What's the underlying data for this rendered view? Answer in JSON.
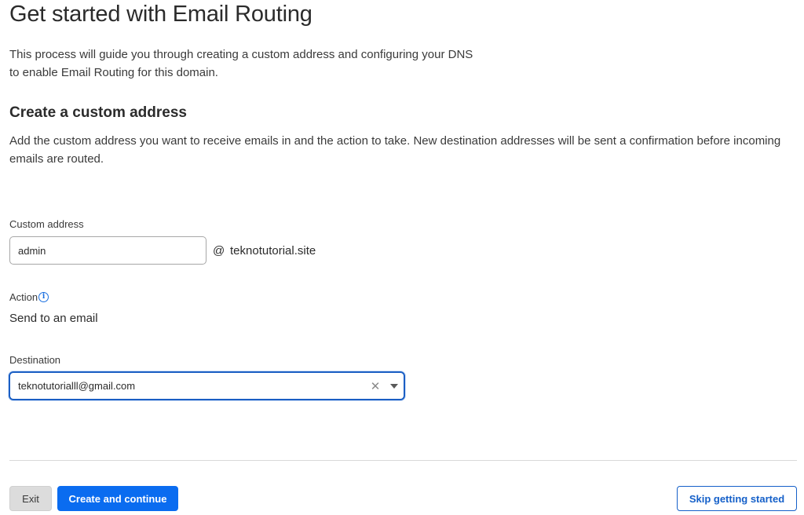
{
  "header": {
    "title": "Get started with Email Routing",
    "intro_line1": "This process will guide you through creating a custom address and configuring your DNS",
    "intro_line2": "to enable Email Routing for this domain."
  },
  "section": {
    "heading": "Create a custom address",
    "description": "Add the custom address you want to receive emails in and the action to take. New destination addresses will be sent a confirmation before incoming emails are routed."
  },
  "custom_address": {
    "label": "Custom address",
    "value": "admin",
    "at": "@",
    "domain": "teknotutorial.site"
  },
  "action": {
    "label": "Action",
    "info_icon": "info-icon",
    "value": "Send to an email"
  },
  "destination": {
    "label": "Destination",
    "selected": "teknotutorialll@gmail.com",
    "clear_icon": "close-icon",
    "dropdown_icon": "caret-down-icon"
  },
  "footer": {
    "exit_label": "Exit",
    "create_label": "Create and continue",
    "skip_label": "Skip getting started"
  },
  "colors": {
    "primary": "#0a6cf0",
    "focus_border": "#1b5fc4",
    "link": "#1560c9"
  }
}
